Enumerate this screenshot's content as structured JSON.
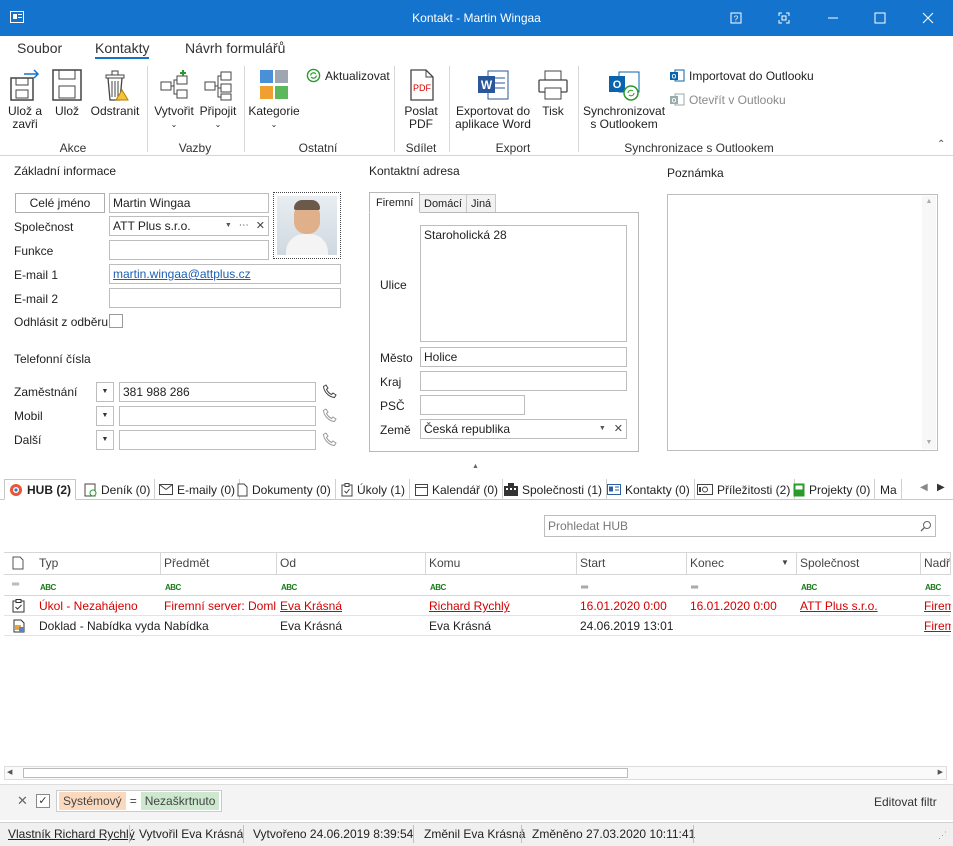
{
  "window": {
    "title": "Kontakt - Martin Wingaa"
  },
  "menu": {
    "tabs": [
      "Soubor",
      "Kontakty",
      "Návrh formulářů"
    ],
    "active": "Kontakty"
  },
  "ribbon": {
    "akce": {
      "label": "Akce",
      "save_close": "Ulož a\nzavři",
      "save": "Ulož",
      "delete": "Odstranit"
    },
    "vazby": {
      "label": "Vazby",
      "create": "Vytvořit",
      "attach": "Připojit"
    },
    "ostatni": {
      "label": "Ostatní",
      "category": "Kategorie",
      "refresh": "Aktualizovat"
    },
    "sdilet": {
      "label": "Sdílet",
      "send_pdf": "Poslat\nPDF"
    },
    "export": {
      "label": "Export",
      "word": "Exportovat do\naplikace Word",
      "print": "Tisk"
    },
    "sync": {
      "label": "Synchronizace s Outlookem",
      "sync_btn": "Synchronizovat\ns Outlookem",
      "import": "Importovat do Outlooku",
      "open": "Otevřít v Outlooku"
    }
  },
  "basic": {
    "heading": "Základní informace",
    "full_name_button": "Celé jméno",
    "full_name": "Martin Wingaa",
    "company_label": "Společnost",
    "company": "ATT Plus s.r.o.",
    "function_label": "Funkce",
    "function": "",
    "email1_label": "E-mail 1",
    "email1": "martin.wingaa@attplus.cz",
    "email2_label": "E-mail 2",
    "email2": "",
    "unsubscribe_label": "Odhlásit z odběru"
  },
  "phones": {
    "heading": "Telefonní čísla",
    "rows": [
      {
        "label": "Zaměstnání",
        "value": "381 988 286"
      },
      {
        "label": "Mobil",
        "value": ""
      },
      {
        "label": "Další",
        "value": ""
      }
    ]
  },
  "address": {
    "heading": "Kontaktní adresa",
    "tabs": [
      "Firemní",
      "Domácí",
      "Jiná"
    ],
    "street_label": "Ulice",
    "street": "Staroholická 28",
    "city_label": "Město",
    "city": "Holice",
    "region_label": "Kraj",
    "region": "",
    "zip_label": "PSČ",
    "zip": "",
    "country_label": "Země",
    "country": "Česká republika"
  },
  "note": {
    "heading": "Poznámka"
  },
  "bottom_tabs": [
    "HUB (2)",
    "Deník (0)",
    "E-maily (0)",
    "Dokumenty (0)",
    "Úkoly (1)",
    "Kalendář (0)",
    "Společnosti (1)",
    "Kontakty (0)",
    "Příležitosti (2)",
    "Projekty (0)",
    "Ma"
  ],
  "search": {
    "placeholder": "Prohledat HUB"
  },
  "grid": {
    "columns": [
      "Typ",
      "Předmět",
      "Od",
      "Komu",
      "Start",
      "Konec",
      "Společnost",
      "Nadř"
    ],
    "rows": [
      {
        "typ": "Úkol - Nezahájeno",
        "predmet": "Firemní server: Doml...",
        "od": "Eva Krásná",
        "komu": "Richard Rychlý",
        "start": "16.01.2020 0:00",
        "konec": "16.01.2020 0:00",
        "spolecnost": "ATT Plus s.r.o.",
        "nadr": "Firem"
      },
      {
        "typ": "Doklad - Nabídka vydaná",
        "predmet": "Nabídka",
        "od": "Eva Krásná",
        "komu": "Eva Krásná",
        "start": "24.06.2019 13:01",
        "konec": "",
        "spolecnost": "",
        "nadr": "Firem"
      }
    ]
  },
  "filter": {
    "field": "Systémový",
    "op": "=",
    "value": "Nezaškrtnuto",
    "edit": "Editovat filtr"
  },
  "status": {
    "owner": "Vlastník Richard Rychlý",
    "created_by": "Vytvořil Eva Krásná",
    "created": "Vytvořeno 24.06.2019 8:39:54",
    "modified_by": "Změnil Eva Krásná",
    "modified": "Změněno 27.03.2020 10:11:41"
  }
}
